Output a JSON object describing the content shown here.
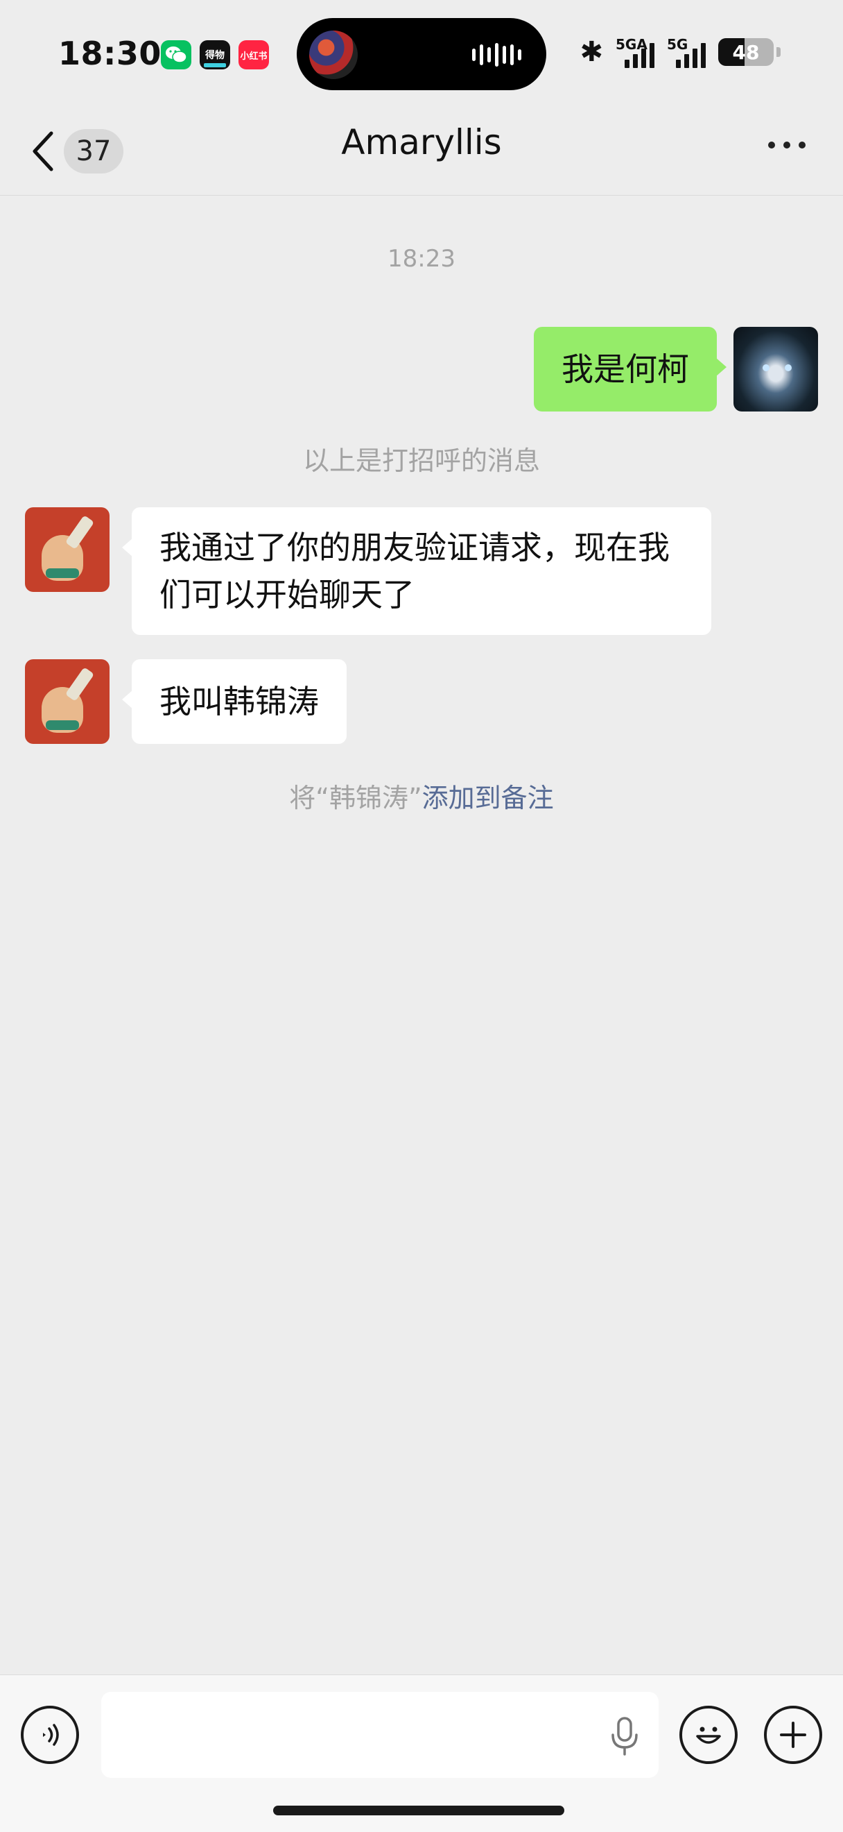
{
  "status_bar": {
    "time": "18:30",
    "notification_apps": [
      {
        "name": "wechat-icon",
        "label": ""
      },
      {
        "name": "dewu-app-icon",
        "label": "得物"
      },
      {
        "name": "xiaohongshu-app-icon",
        "label": "小红书"
      }
    ],
    "signal_1_label": "5GA",
    "signal_2_label": "5G",
    "battery_level": "48",
    "battery_fraction": 0.48
  },
  "nav": {
    "unread_count": "37",
    "title": "Amaryllis",
    "icons": {
      "back": "chevron-left-icon",
      "more": "more-dots-icon"
    }
  },
  "chat": {
    "timestamp": "18:23",
    "messages": [
      {
        "side": "self",
        "text": "我是何柯"
      },
      {
        "side": "peer",
        "text": "我通过了你的朋友验证请求，现在我们可以开始聊天了"
      },
      {
        "side": "peer",
        "text": "我叫韩锦涛"
      }
    ],
    "greeting_note": "以上是打招呼的消息",
    "remark_prefix": "将“韩锦涛”",
    "remark_link": "添加到备注"
  },
  "input_bar": {
    "text_value": "",
    "icons": {
      "voice": "voice-input-icon",
      "mic": "microphone-icon",
      "emoji": "emoji-icon",
      "plus": "plus-icon"
    }
  },
  "colors": {
    "background": "#ededed",
    "self_bubble": "#95ec69",
    "peer_bubble": "#ffffff",
    "link": "#576b95",
    "wechat_green": "#07c160"
  }
}
